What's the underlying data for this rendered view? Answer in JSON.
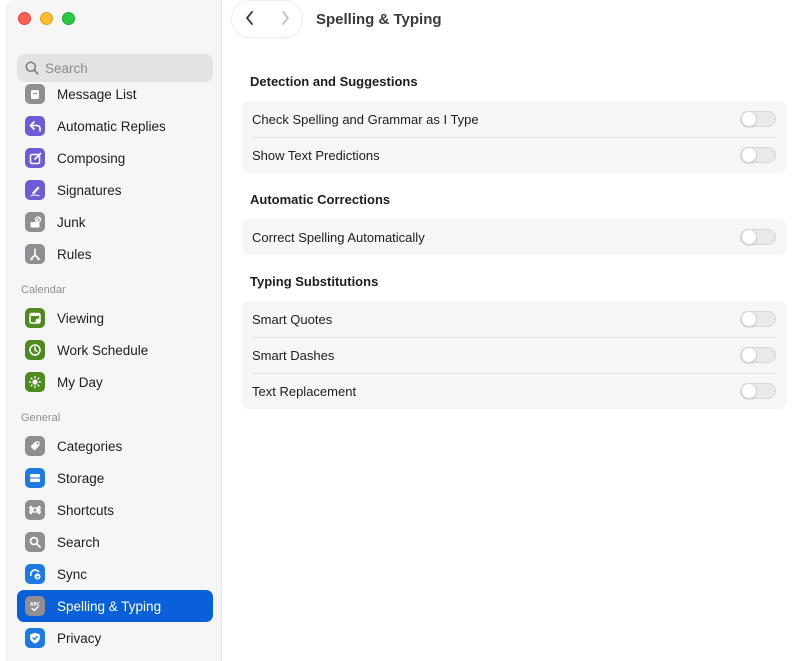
{
  "window": {
    "title": "Spelling & Typing"
  },
  "search": {
    "placeholder": "Search"
  },
  "sidebar": {
    "mail_items": [
      {
        "label": "Message List",
        "icon": "message-list-icon",
        "color": "#8e8e93"
      },
      {
        "label": "Automatic Replies",
        "icon": "reply-arrow-icon",
        "color": "#6e5cd6"
      },
      {
        "label": "Composing",
        "icon": "compose-icon",
        "color": "#6e5cd6"
      },
      {
        "label": "Signatures",
        "icon": "signature-pen-icon",
        "color": "#6e5cd6"
      },
      {
        "label": "Junk",
        "icon": "junk-icon",
        "color": "#8e8e93"
      },
      {
        "label": "Rules",
        "icon": "rules-icon",
        "color": "#8e8e93"
      }
    ],
    "calendar_label": "Calendar",
    "calendar_items": [
      {
        "label": "Viewing",
        "icon": "calendar-view-icon",
        "color": "#4e8a1f"
      },
      {
        "label": "Work Schedule",
        "icon": "clock-icon",
        "color": "#4e8a1f"
      },
      {
        "label": "My Day",
        "icon": "sun-icon",
        "color": "#4e8a1f"
      }
    ],
    "general_label": "General",
    "general_items": [
      {
        "label": "Categories",
        "icon": "tag-icon",
        "color": "#8e8e93"
      },
      {
        "label": "Storage",
        "icon": "storage-icon",
        "color": "#1e7ae0"
      },
      {
        "label": "Shortcuts",
        "icon": "command-icon",
        "color": "#8e8e93"
      },
      {
        "label": "Search",
        "icon": "magnifier-icon",
        "color": "#8e8e93"
      },
      {
        "label": "Sync",
        "icon": "sync-icon",
        "color": "#1e7ae0"
      },
      {
        "label": "Spelling & Typing",
        "icon": "abc-check-icon",
        "color": "#8e8e93",
        "active": true
      },
      {
        "label": "Privacy",
        "icon": "shield-icon",
        "color": "#1e7ae0"
      }
    ]
  },
  "groups": [
    {
      "title": "Detection and Suggestions",
      "rows": [
        {
          "label": "Check Spelling and Grammar as I Type",
          "on": false
        },
        {
          "label": "Show Text Predictions",
          "on": false
        }
      ]
    },
    {
      "title": "Automatic Corrections",
      "rows": [
        {
          "label": "Correct Spelling Automatically",
          "on": false
        }
      ]
    },
    {
      "title": "Typing Substitutions",
      "rows": [
        {
          "label": "Smart Quotes",
          "on": false
        },
        {
          "label": "Smart Dashes",
          "on": false
        },
        {
          "label": "Text Replacement",
          "on": false
        }
      ]
    }
  ]
}
